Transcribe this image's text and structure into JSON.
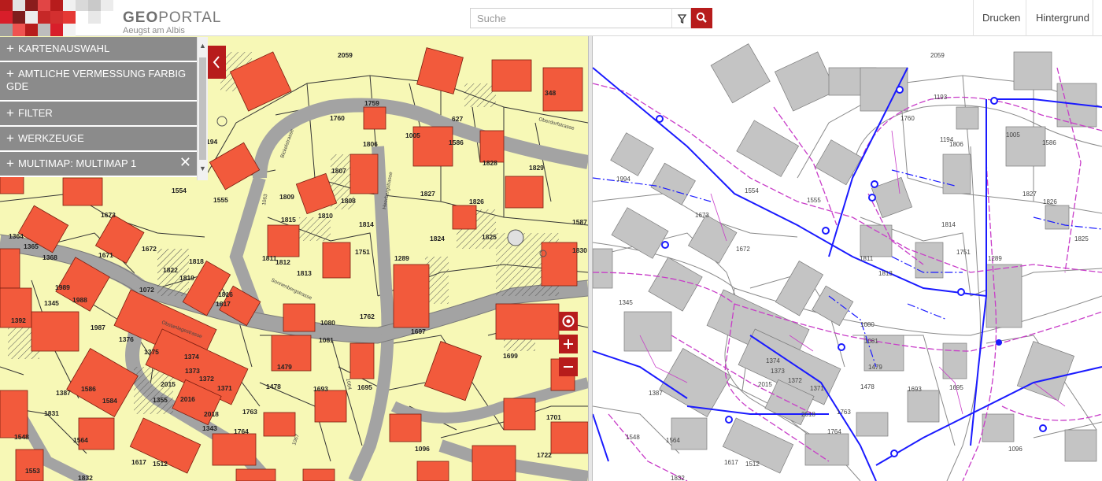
{
  "header": {
    "logo_title_bold": "GEO",
    "logo_title_rest": "PORTAL",
    "logo_subtitle": "Aeugst am Albis",
    "search_placeholder": "Suche",
    "print_label": "Drucken",
    "background_label": "Hintergrund"
  },
  "menu": {
    "items": [
      {
        "label": "KARTENAUSWAHL"
      },
      {
        "label": "AMTLICHE VERMESSUNG FARBIG GDE"
      },
      {
        "label": "FILTER"
      },
      {
        "label": "WERKZEUGE"
      },
      {
        "label": "MULTIMAP: MULTIMAP 1"
      }
    ]
  },
  "map_labels": [
    "2059",
    "1759",
    "627",
    "1760",
    "1806",
    "1005",
    "1586",
    "1826",
    "1829",
    "348",
    "1807",
    "1808",
    "1809",
    "1810",
    "1814",
    "1827",
    "1826",
    "1825",
    "1587",
    "1824",
    "1815",
    "1811",
    "1812",
    "1813",
    "1751",
    "1289",
    "1830",
    "1554",
    "1555",
    "1673",
    "1672",
    "1671",
    "1364",
    "1365",
    "1368",
    "1989",
    "1988",
    "1345",
    "1072",
    "1818",
    "1819",
    "1822",
    "1817",
    "1816",
    "1392",
    "1987",
    "1376",
    "1375",
    "1373",
    "1374",
    "1372",
    "1371",
    "1762",
    "1080",
    "1081",
    "1479",
    "1478",
    "1693",
    "1695",
    "1697",
    "1698",
    "1699",
    "1387",
    "1586",
    "1584",
    "2015",
    "2016",
    "2018",
    "1343",
    "1355",
    "1353",
    "1763",
    "1764",
    "1831",
    "1548",
    "1564",
    "1617",
    "1512",
    "1553",
    "1832",
    "1096",
    "1722",
    "1701",
    "1063",
    "194",
    "1193",
    "1194",
    "1994",
    "1289"
  ],
  "colors": {
    "accent": "#b71c1c",
    "parcel_fill": "#f7f8b6",
    "building": "#f25a3c",
    "road": "#a8a8a8",
    "menu_bg": "#8b8b8b",
    "pipe_blue": "#1a1aff",
    "pipe_magenta": "#c83cc8"
  },
  "icons": {
    "search": "search-icon",
    "filter": "filter-icon",
    "collapse": "chevron-left-icon",
    "locate": "locate-icon",
    "zoom_in": "plus-icon",
    "zoom_out": "minus-icon"
  }
}
